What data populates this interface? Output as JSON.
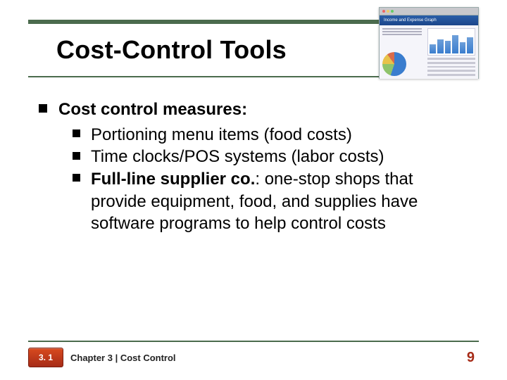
{
  "theme": {
    "accent": "#a62b17",
    "rule": "#4b6b4d"
  },
  "title": "Cost-Control Tools",
  "thumbnail": {
    "app_header": "Income and Expense Graph"
  },
  "bullets": {
    "heading": "Cost control measures:",
    "items": [
      {
        "text_full": "Portioning menu items (food costs)"
      },
      {
        "text_full": "Time clocks/POS systems (labor costs)"
      },
      {
        "bold_lead": "Full-line supplier co.",
        "rest": ": one-stop shops that provide equipment, food, and supplies have software programs to help control costs"
      }
    ]
  },
  "footer": {
    "badge": "3. 1",
    "chapter": "Chapter 3 | Cost Control",
    "page": "9"
  }
}
